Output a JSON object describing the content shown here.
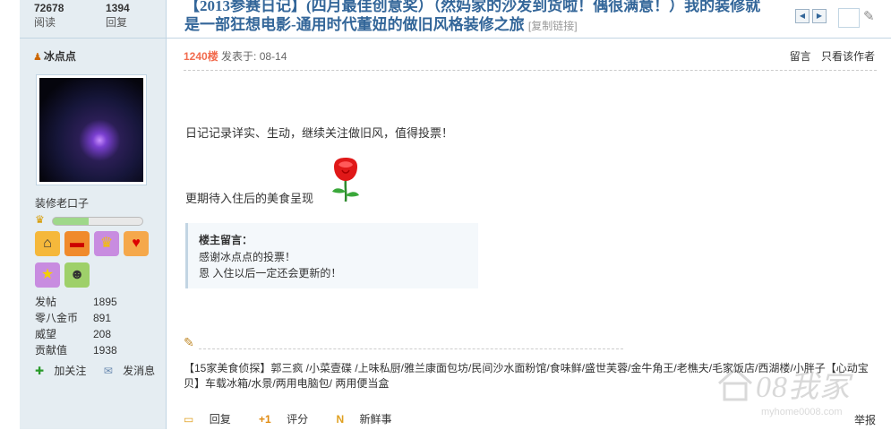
{
  "stats": {
    "views_value": "72678",
    "views_label": "阅读",
    "replies_value": "1394",
    "replies_label": "回复"
  },
  "thread": {
    "title": "【2013参赛日记】(四月最佳创意奖）（然妈家的沙发到货啦！偶很满意！）我的装修就是一部狂想电影-通用时代董妞的做旧风格装修之旅",
    "copy_link": "[复制链接]"
  },
  "user": {
    "name": "冰点点",
    "group": "装修老口子",
    "level_progress": 0.4,
    "stats": [
      {
        "label": "发帖",
        "value": "1895"
      },
      {
        "label": "零八金币",
        "value": "891"
      },
      {
        "label": "威望",
        "value": "208"
      },
      {
        "label": "贡献值",
        "value": "1938"
      }
    ],
    "add_follow": "加关注",
    "send_message": "发消息"
  },
  "post": {
    "floor": "1240楼",
    "posted_at": "发表于: 08-14",
    "tool_message": "留言",
    "tool_author_only": "只看该作者",
    "line1": "日记记录详实、生动，继续关注做旧风，值得投票！",
    "line2": "更期待入住后的美食呈现",
    "quote_header": "楼主留言：",
    "quote_line1": "感谢冰点点的投票！",
    "quote_line2": "恩 入住以后一定还会更新的！",
    "signature": "【15家美食侦探】郭三疯 /小菜壹碟  /上味私厨/雅兰康面包坊/民间沙水面粉馆/食味鲜/盛世芙蓉/金牛角王/老樵夫/毛家饭店/西湖楼/小胖子【心动宝贝】车载冰箱/水景/两用电脑包/ 两用便当盒"
  },
  "footer": {
    "reply": "回复",
    "rate": "评分",
    "fresh": "新鲜事",
    "report": "举报"
  },
  "icons": [
    "user-icon",
    "house-medal-icon",
    "sofa-medal-icon",
    "crown-medal-icon",
    "heart-medal-icon",
    "star-medal-icon",
    "bee-medal-icon",
    "plus-icon",
    "message-icon",
    "pencil-icon",
    "reply-icon",
    "rate-icon",
    "fresh-icon",
    "wrench-icon"
  ],
  "watermark": {
    "text": "08我家",
    "sub": "myhome0008.com"
  },
  "colors": {
    "sidebar_bg": "#E5EDF2",
    "title": "#336699",
    "floor": "#F26C4F",
    "border": "#C2D5E3"
  }
}
